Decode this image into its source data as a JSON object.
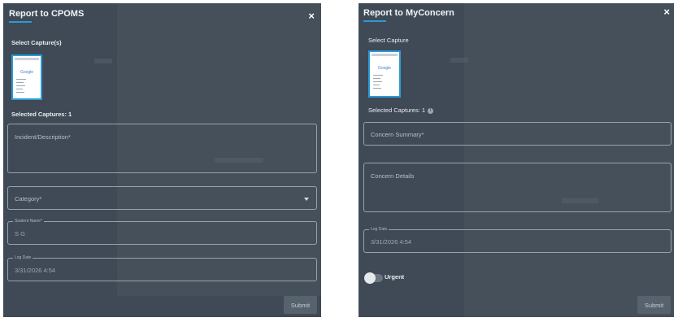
{
  "left": {
    "title": "Report to CPOMS",
    "close": "×",
    "select_label": "Select Capture(s)",
    "thumb_logo": "Google",
    "selected_count": "Selected Captures: 1",
    "incident_placeholder": "Incident/Description*",
    "category_placeholder": "Category*",
    "student_legend": "Student Name*",
    "student_value": "S G",
    "logdate_legend": "Log Date",
    "logdate_value": "3/31/2026 4:54",
    "submit": "Submit"
  },
  "right": {
    "title": "Report to MyConcern",
    "close": "×",
    "select_label": "Select Capture",
    "thumb_logo": "Google",
    "selected_count": "Selected Captures: 1",
    "info": "i",
    "summary_placeholder": "Concern Summary*",
    "details_placeholder": "Concern Details",
    "logdate_legend": "Log Date",
    "logdate_value": "3/31/2026 4:54",
    "urgent_label": "Urgent",
    "urgent_on": false,
    "submit": "Submit"
  },
  "colors": {
    "panel_bg": "#3f4a56",
    "accent": "#2b9ad6"
  }
}
